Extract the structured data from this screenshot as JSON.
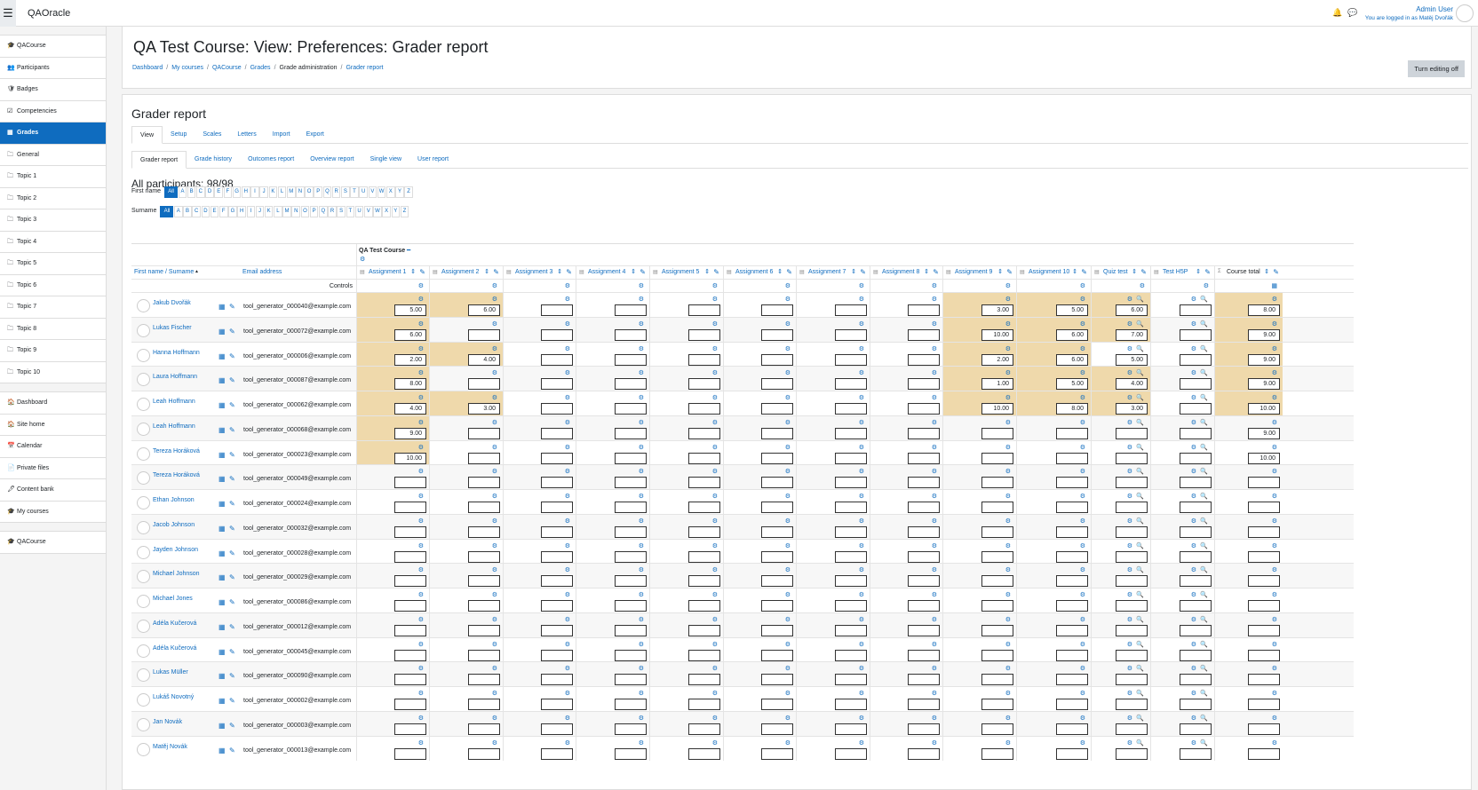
{
  "topbar": {
    "site_name": "QAOracle",
    "user_name": "Admin User",
    "logged_in_as": "You are logged in as Matěj Dvořák"
  },
  "nav": {
    "group1": [
      "QACourse",
      "Participants",
      "Badges",
      "Competencies",
      "Grades",
      "General",
      "Topic 1",
      "Topic 2",
      "Topic 3",
      "Topic 4",
      "Topic 5",
      "Topic 6",
      "Topic 7",
      "Topic 8",
      "Topic 9",
      "Topic 10"
    ],
    "group2": [
      "Dashboard",
      "Site home",
      "Calendar",
      "Private files",
      "Content bank",
      "My courses"
    ],
    "group3": [
      "QACourse"
    ],
    "active": "Grades"
  },
  "header": {
    "title": "QA Test Course: View: Preferences: Grader report",
    "breadcrumb": [
      "Dashboard",
      "My courses",
      "QACourse",
      "Grades",
      "Grade administration",
      "Grader report"
    ],
    "turn_editing_label": "Turn editing off"
  },
  "report": {
    "title": "Grader report",
    "tabs1": [
      "View",
      "Setup",
      "Scales",
      "Letters",
      "Import",
      "Export"
    ],
    "tabs2": [
      "Grader report",
      "Grade history",
      "Outcomes report",
      "Overview report",
      "Single view",
      "User report"
    ],
    "participants": "All participants: 98/98",
    "firstname_label": "First name",
    "surname_label": "Surname",
    "all_label": "All",
    "letters": [
      "A",
      "B",
      "C",
      "D",
      "E",
      "F",
      "G",
      "H",
      "I",
      "J",
      "K",
      "L",
      "M",
      "N",
      "O",
      "P",
      "Q",
      "R",
      "S",
      "T",
      "U",
      "V",
      "W",
      "X",
      "Y",
      "Z"
    ]
  },
  "grid": {
    "category": "QA Test Course",
    "name_header": "First name / Surname",
    "email_header": "Email address",
    "controls_label": "Controls",
    "columns": [
      "Assignment 1",
      "Assignment 2",
      "Assignment 3",
      "Assignment 4",
      "Assignment 5",
      "Assignment 6",
      "Assignment 7",
      "Assignment 8",
      "Assignment 9",
      "Assignment 10",
      "Quiz test",
      "Test H5P",
      "Course total"
    ],
    "rows": [
      {
        "name": "Jakub Dvořák",
        "email": "tool_generator_000040@example.com",
        "grades": [
          "5.00",
          "6.00",
          "",
          "",
          "",
          "",
          "",
          "",
          "3.00",
          "5.00",
          "6.00",
          "",
          "8.00"
        ]
      },
      {
        "name": "Lukas Fischer",
        "email": "tool_generator_000072@example.com",
        "grades": [
          "6.00",
          "",
          "",
          "",
          "",
          "",
          "",
          "",
          "10.00",
          "6.00",
          "7.00",
          "",
          "9.00"
        ]
      },
      {
        "name": "Hanna Hoffmann",
        "email": "tool_generator_000006@example.com",
        "grades": [
          "2.00",
          "4.00",
          "",
          "",
          "",
          "",
          "",
          "",
          "2.00",
          "6.00",
          "5.00",
          "",
          "9.00"
        ]
      },
      {
        "name": "Laura Hoffmann",
        "email": "tool_generator_000087@example.com",
        "grades": [
          "8.00",
          "",
          "",
          "",
          "",
          "",
          "",
          "",
          "1.00",
          "5.00",
          "4.00",
          "",
          "9.00"
        ]
      },
      {
        "name": "Leah Hoffmann",
        "email": "tool_generator_000062@example.com",
        "grades": [
          "4.00",
          "3.00",
          "",
          "",
          "",
          "",
          "",
          "",
          "10.00",
          "8.00",
          "3.00",
          "",
          "10.00"
        ]
      },
      {
        "name": "Leah Hoffmann",
        "email": "tool_generator_000068@example.com",
        "grades": [
          "9.00",
          "",
          "",
          "",
          "",
          "",
          "",
          "",
          "",
          "",
          "",
          "",
          "9.00"
        ]
      },
      {
        "name": "Tereza Horáková",
        "email": "tool_generator_000023@example.com",
        "grades": [
          "10.00",
          "",
          "",
          "",
          "",
          "",
          "",
          "",
          "",
          "",
          "",
          "",
          "10.00"
        ]
      },
      {
        "name": "Tereza Horáková",
        "email": "tool_generator_000049@example.com",
        "grades": [
          "",
          "",
          "",
          "",
          "",
          "",
          "",
          "",
          "",
          "",
          "",
          "",
          ""
        ]
      },
      {
        "name": "Ethan Johnson",
        "email": "tool_generator_000024@example.com",
        "grades": [
          "",
          "",
          "",
          "",
          "",
          "",
          "",
          "",
          "",
          "",
          "",
          "",
          ""
        ]
      },
      {
        "name": "Jacob Johnson",
        "email": "tool_generator_000032@example.com",
        "grades": [
          "",
          "",
          "",
          "",
          "",
          "",
          "",
          "",
          "",
          "",
          "",
          "",
          ""
        ]
      },
      {
        "name": "Jayden Johnson",
        "email": "tool_generator_000028@example.com",
        "grades": [
          "",
          "",
          "",
          "",
          "",
          "",
          "",
          "",
          "",
          "",
          "",
          "",
          ""
        ]
      },
      {
        "name": "Michael Johnson",
        "email": "tool_generator_000029@example.com",
        "grades": [
          "",
          "",
          "",
          "",
          "",
          "",
          "",
          "",
          "",
          "",
          "",
          "",
          ""
        ]
      },
      {
        "name": "Michael Jones",
        "email": "tool_generator_000086@example.com",
        "grades": [
          "",
          "",
          "",
          "",
          "",
          "",
          "",
          "",
          "",
          "",
          "",
          "",
          ""
        ]
      },
      {
        "name": "Adéla Kučerová",
        "email": "tool_generator_000012@example.com",
        "grades": [
          "",
          "",
          "",
          "",
          "",
          "",
          "",
          "",
          "",
          "",
          "",
          "",
          ""
        ]
      },
      {
        "name": "Adéla Kučerová",
        "email": "tool_generator_000045@example.com",
        "grades": [
          "",
          "",
          "",
          "",
          "",
          "",
          "",
          "",
          "",
          "",
          "",
          "",
          ""
        ]
      },
      {
        "name": "Lukas Müller",
        "email": "tool_generator_000090@example.com",
        "grades": [
          "",
          "",
          "",
          "",
          "",
          "",
          "",
          "",
          "",
          "",
          "",
          "",
          ""
        ]
      },
      {
        "name": "Lukáš Novotný",
        "email": "tool_generator_000002@example.com",
        "grades": [
          "",
          "",
          "",
          "",
          "",
          "",
          "",
          "",
          "",
          "",
          "",
          "",
          ""
        ]
      },
      {
        "name": "Jan Novák",
        "email": "tool_generator_000003@example.com",
        "grades": [
          "",
          "",
          "",
          "",
          "",
          "",
          "",
          "",
          "",
          "",
          "",
          "",
          ""
        ]
      },
      {
        "name": "Matěj Novák",
        "email": "tool_generator_000013@example.com",
        "grades": [
          "",
          "",
          "",
          "",
          "",
          "",
          "",
          "",
          "",
          "",
          "",
          "",
          ""
        ]
      }
    ],
    "highlight": [
      [
        0,
        1,
        8,
        9,
        10,
        12
      ],
      [
        0,
        8,
        9,
        10,
        12
      ],
      [
        0,
        1,
        8,
        9,
        12
      ],
      [
        0,
        8,
        9,
        10,
        12
      ],
      [
        0,
        1,
        8,
        9,
        10,
        12
      ],
      [
        0
      ],
      [
        0
      ],
      [],
      [],
      [],
      [],
      [],
      [],
      [],
      [],
      [],
      [],
      [],
      []
    ]
  },
  "colors": {
    "accent": "#0f6cbf",
    "highlight": "#efd9ab"
  }
}
